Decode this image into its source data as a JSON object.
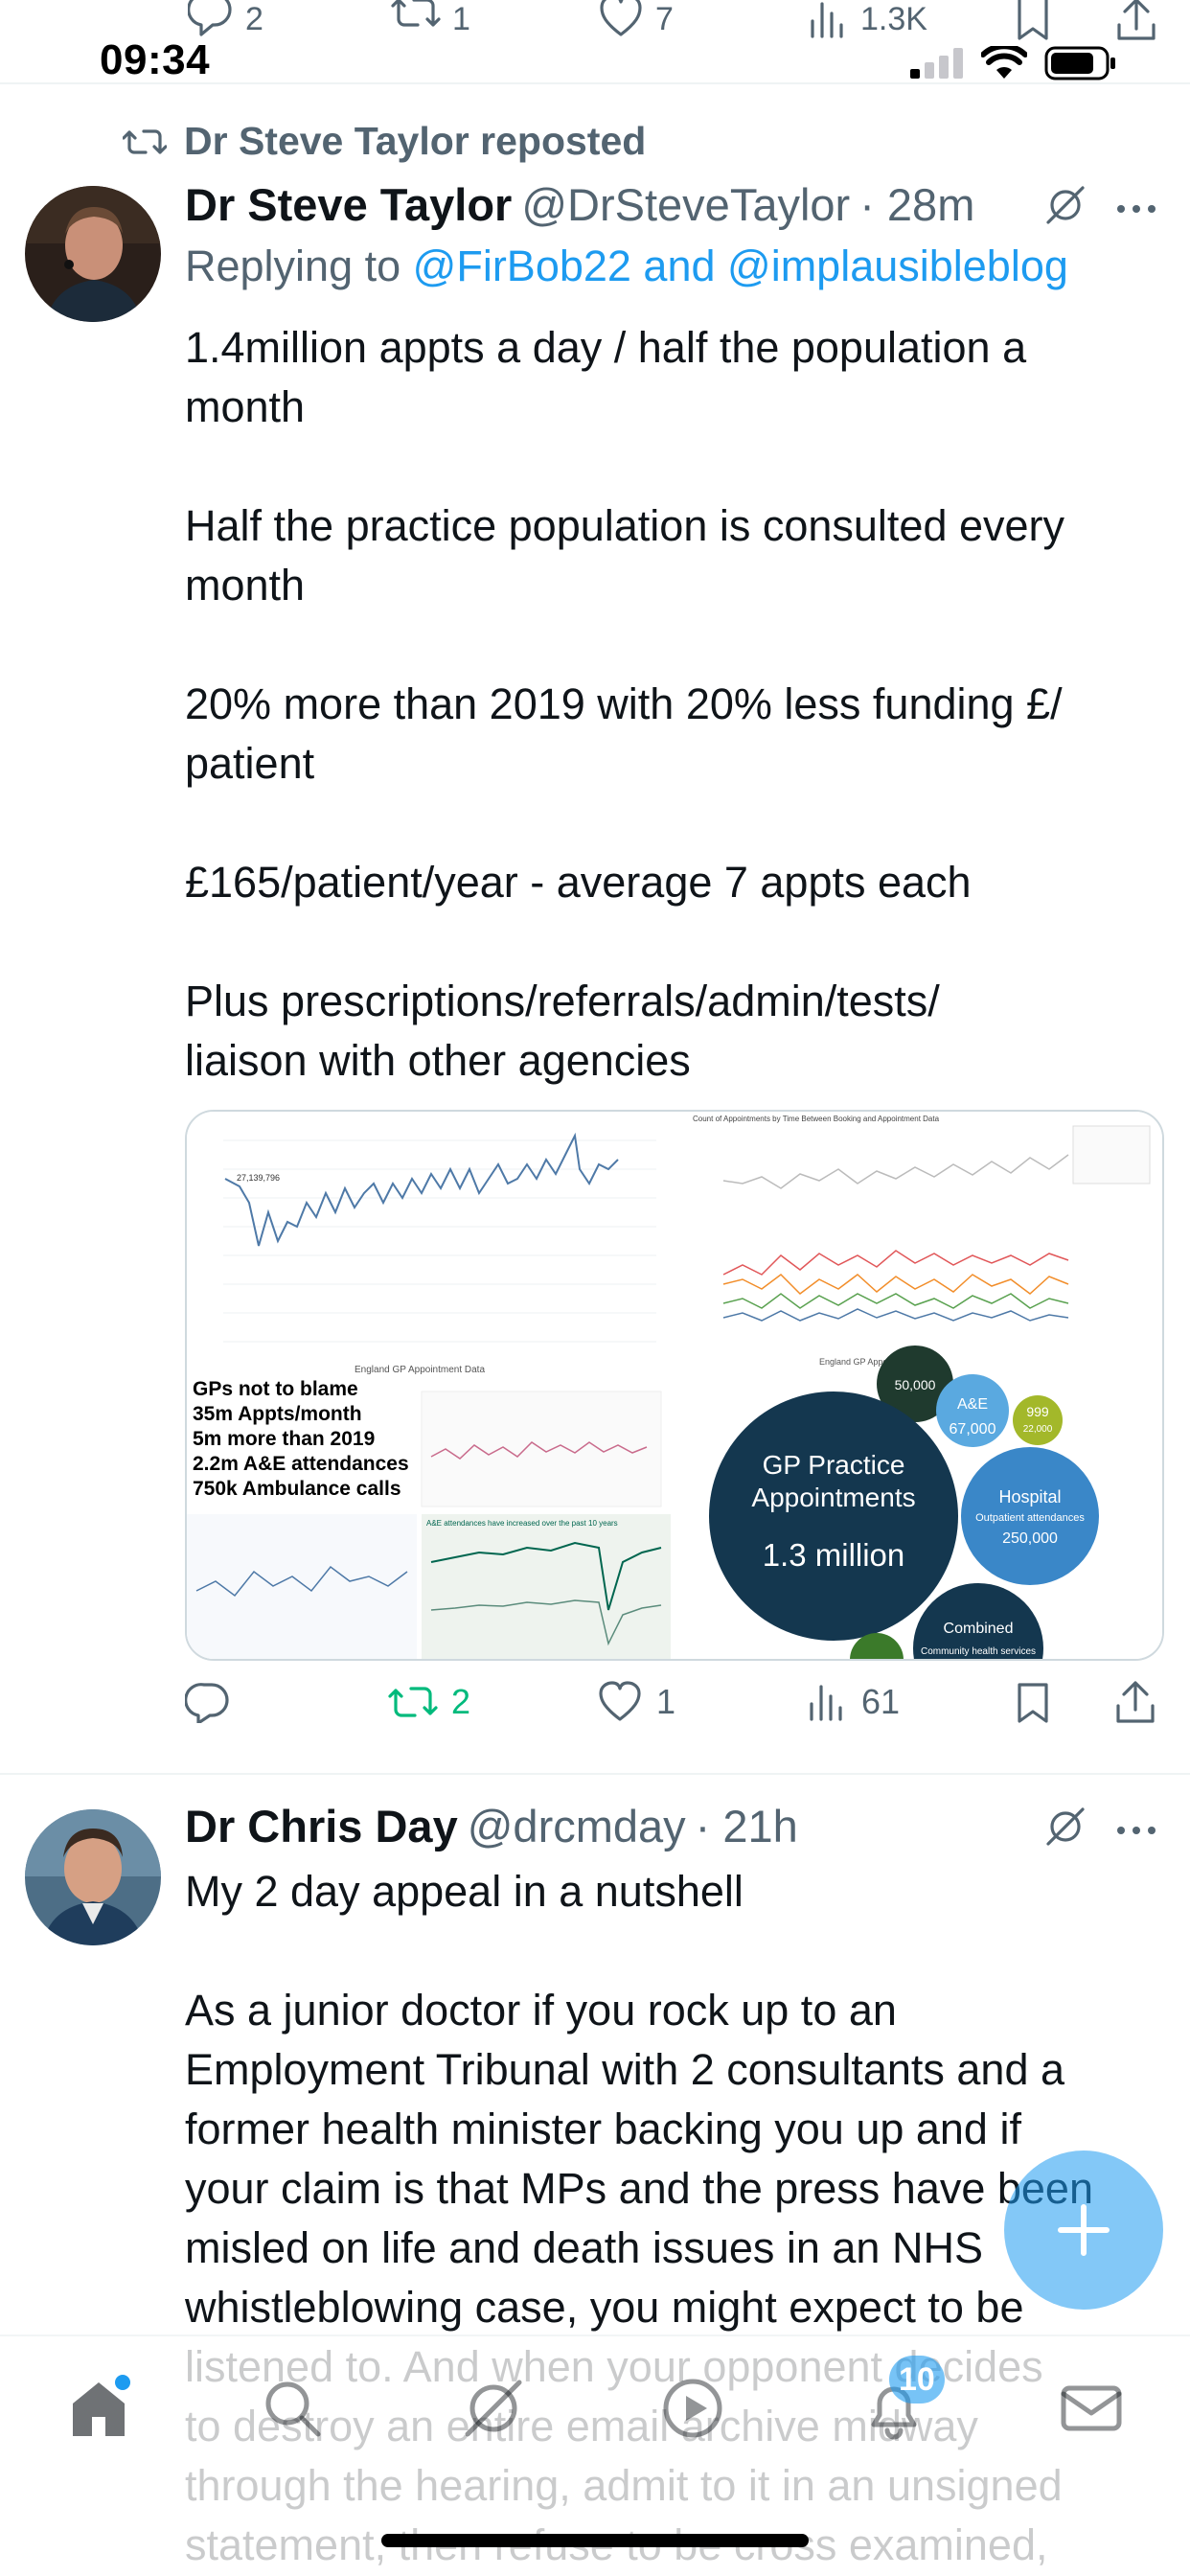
{
  "status_bar": {
    "time": "09:34"
  },
  "prev_tweet_actions": {
    "replies": "2",
    "reposts": "1",
    "likes": "7",
    "views": "1.3K"
  },
  "repost_context": {
    "label": "Dr Steve Taylor reposted"
  },
  "tweet1": {
    "author_name": "Dr Steve Taylor",
    "handle": "@DrSteveTaylor",
    "time": "· 28m",
    "replying_prefix": "Replying to",
    "replying_mentions": "@FirBob22 and @implausibleblog",
    "lines": [
      "1.4million appts a day / half the population a",
      "month",
      "",
      "Half the practice population is consulted every",
      "month",
      "",
      "20% more than 2019 with 20% less funding £/",
      "patient",
      "",
      "£165/patient/year - average 7 appts each",
      "",
      "Plus prescriptions/referrals/admin/tests/",
      "liaison with other agencies"
    ],
    "media": {
      "chart1_footer": "England GP Appointment Data",
      "chart1_start": "27,139,796",
      "chart2_title": "Count of Appointments by Time Between Booking and Appointment Data",
      "chart2_footer": "England GP Appointment Data",
      "infographic_lines": [
        "GPs not to blame",
        "35m Appts/month",
        "5m more than 2019",
        "2.2m A&E attendances",
        "750k Ambulance calls"
      ],
      "ae_chart_title": "A&E attendances have increased over the past 10 years",
      "bubble_main_l1": "GP Practice",
      "bubble_main_l2": "Appointments",
      "bubble_main_value": "1.3 million",
      "bubble_ae_label": "A&E",
      "bubble_ae_value": "67,000",
      "bubble_999_label": "999",
      "bubble_999_value": "22,000",
      "bubble_hosp_label": "Hospital",
      "bubble_hosp_sub": "Outpatient attendances",
      "bubble_hosp_value": "250,000",
      "bubble_comb_label": "Combined",
      "bubble_comb_sub": "Community health services",
      "bubble_top_value": "50,000"
    },
    "actions": {
      "reposts": "2",
      "likes": "1",
      "views": "61"
    }
  },
  "tweet2": {
    "author_name": "Dr Chris Day",
    "handle": "@drcmday",
    "time": "· 21h",
    "lines": [
      "My 2 day appeal in a nutshell",
      "",
      "As a junior doctor if you rock up to an",
      "Employment Tribunal with 2 consultants and a",
      "former health minister backing you up and if",
      "your claim is that MPs and the press have been",
      "misled on life and death issues in an NHS",
      "whistleblowing case, you might expect to be",
      "listened to. And when your opponent decides",
      "to destroy an entire email archive midway",
      "through the hearing, admit to it in an unsigned",
      "statement, then refuse to be cross examined,"
    ]
  },
  "bottom_nav": {
    "notifications_badge": "10"
  },
  "colors": {
    "accent": "#1d9bf0",
    "repost_green": "#00ba7c",
    "secondary_text": "#536471",
    "primary_text": "#0f1419"
  },
  "icons": [
    "reply-icon",
    "repost-icon",
    "like-icon",
    "views-icon",
    "bookmark-icon",
    "share-icon",
    "grok-icon",
    "more-icon",
    "home-icon",
    "search-icon",
    "grok-nav-icon",
    "video-icon",
    "notifications-icon",
    "messages-icon",
    "compose-icon"
  ]
}
